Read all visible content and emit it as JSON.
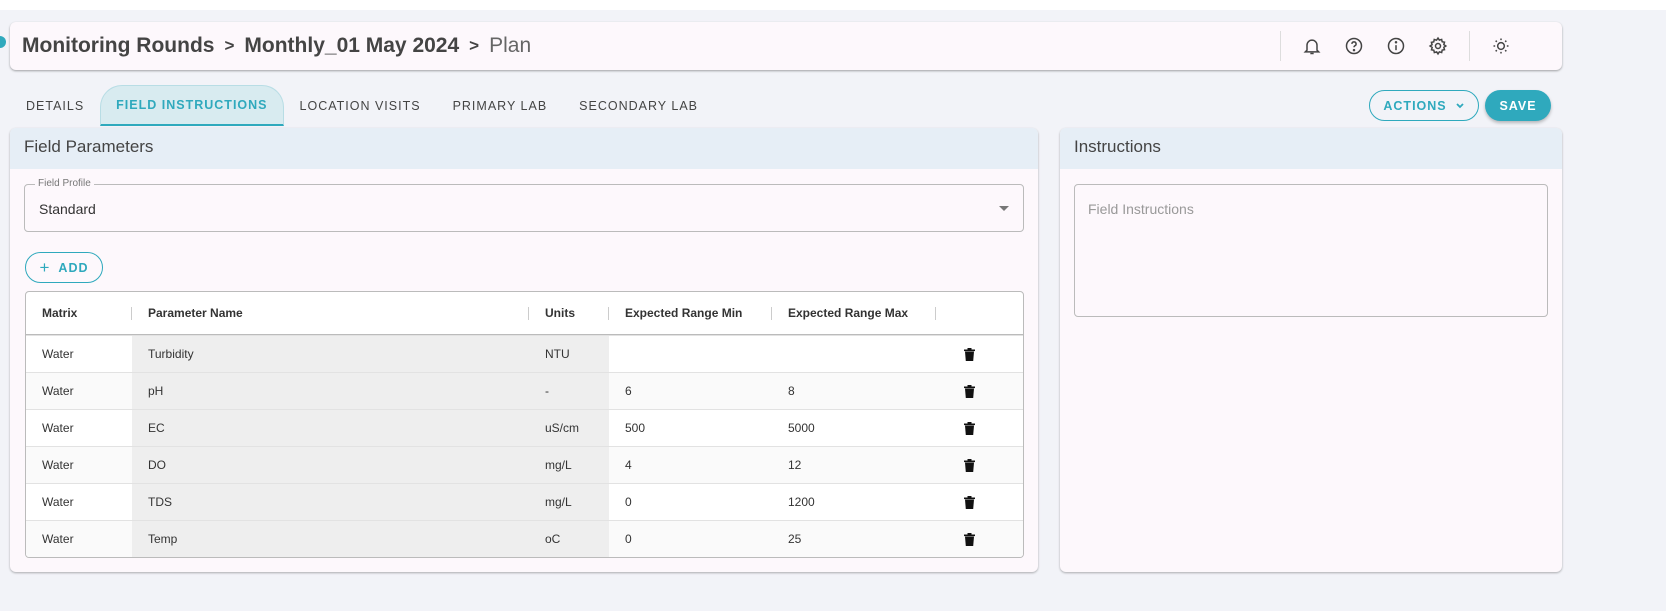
{
  "breadcrumb": [
    "Monitoring Rounds",
    "Monthly_01 May 2024",
    "Plan"
  ],
  "tabs": [
    "DETAILS",
    "FIELD INSTRUCTIONS",
    "LOCATION VISITS",
    "PRIMARY LAB",
    "SECONDARY LAB"
  ],
  "active_tab": "FIELD INSTRUCTIONS",
  "actions_label": "ACTIONS",
  "save_label": "SAVE",
  "header_icons": [
    "bell-icon",
    "help-icon",
    "info-icon",
    "gear-icon",
    "theme-icon"
  ],
  "field_parameters": {
    "title": "Field Parameters",
    "profile_label": "Field Profile",
    "profile_value": "Standard",
    "add_label": "ADD",
    "columns": [
      "Matrix",
      "Parameter Name",
      "Units",
      "Expected Range Min",
      "Expected Range Max",
      ""
    ],
    "rows": [
      [
        "Water",
        "Turbidity",
        "NTU",
        "",
        ""
      ],
      [
        "Water",
        "pH",
        "-",
        "6",
        "8"
      ],
      [
        "Water",
        "EC",
        "uS/cm",
        "500",
        "5000"
      ],
      [
        "Water",
        "DO",
        "mg/L",
        "4",
        "12"
      ],
      [
        "Water",
        "TDS",
        "mg/L",
        "0",
        "1200"
      ],
      [
        "Water",
        "Temp",
        "oC",
        "0",
        "25"
      ]
    ]
  },
  "instructions": {
    "title": "Instructions",
    "placeholder": "Field Instructions"
  },
  "colors": {
    "accent": "#2fa9bd"
  }
}
